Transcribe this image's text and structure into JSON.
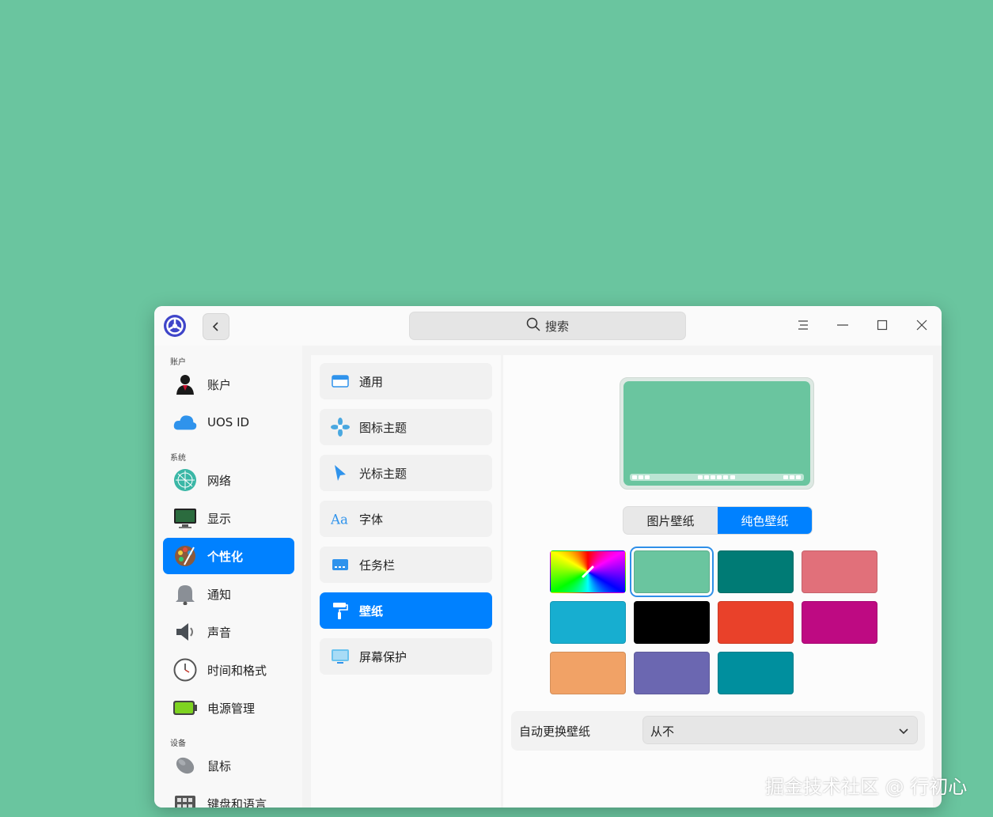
{
  "search": {
    "label": "搜索"
  },
  "sidebar": {
    "sections": {
      "accounts": "账户",
      "system": "系统",
      "devices": "设备"
    },
    "items": [
      {
        "label": "账户"
      },
      {
        "label": "UOS ID"
      },
      {
        "label": "网络"
      },
      {
        "label": "显示"
      },
      {
        "label": "个性化"
      },
      {
        "label": "通知"
      },
      {
        "label": "声音"
      },
      {
        "label": "时间和格式"
      },
      {
        "label": "电源管理"
      },
      {
        "label": "鼠标"
      },
      {
        "label": "键盘和语言"
      }
    ]
  },
  "submenu": {
    "items": [
      {
        "label": "通用"
      },
      {
        "label": "图标主题"
      },
      {
        "label": "光标主题"
      },
      {
        "label": "字体"
      },
      {
        "label": "任务栏"
      },
      {
        "label": "壁纸"
      },
      {
        "label": "屏幕保护"
      }
    ]
  },
  "wallpaper": {
    "tabs": {
      "picture": "图片壁纸",
      "solid": "纯色壁纸"
    },
    "preview_color": "#6ac59f",
    "colors": [
      "#6ac59f",
      "#007b75",
      "#e1707a",
      "#17aed0",
      "#000000",
      "#e9412a",
      "#be0a82",
      "#f1a266",
      "#6b67b1",
      "#008f9e"
    ],
    "auto_change_label": "自动更换壁纸",
    "auto_change_value": "从不"
  },
  "watermark": "掘金技术社区 @ 行初心"
}
